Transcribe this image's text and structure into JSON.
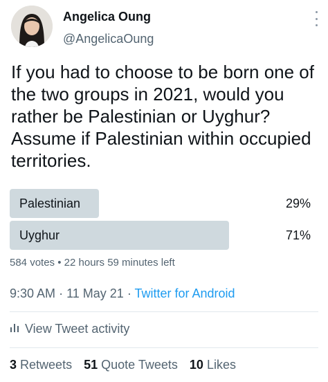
{
  "author": {
    "name": "Angelica Oung",
    "handle": "@AngelicaOung"
  },
  "tweet": {
    "text": "If you had to choose to be born one of the two groups in 2021, would you rather be Palestinian or Uyghur? Assume if Palestinian within occupied territories."
  },
  "poll": {
    "options": [
      {
        "label": "Palestinian",
        "percent_text": "29%",
        "fraction": 0.29
      },
      {
        "label": "Uyghur",
        "percent_text": "71%",
        "fraction": 0.71
      }
    ],
    "votes": "584 votes",
    "separator": "•",
    "time_left": "22 hours 59 minutes left",
    "bar_color": "#cfd9de"
  },
  "meta": {
    "time": "9:30 AM",
    "dot": "·",
    "date": "11 May 21",
    "dot2": "·",
    "source": "Twitter for Android"
  },
  "activity": {
    "icon": "bar-chart-icon",
    "label": "View Tweet activity"
  },
  "stats": {
    "retweets_count": "3",
    "retweets_label": "Retweets",
    "quotes_count": "51",
    "quotes_label": "Quote Tweets",
    "likes_count": "10",
    "likes_label": "Likes"
  },
  "colors": {
    "text_primary": "#0f1419",
    "text_secondary": "#536471",
    "link": "#1d9bf0"
  }
}
